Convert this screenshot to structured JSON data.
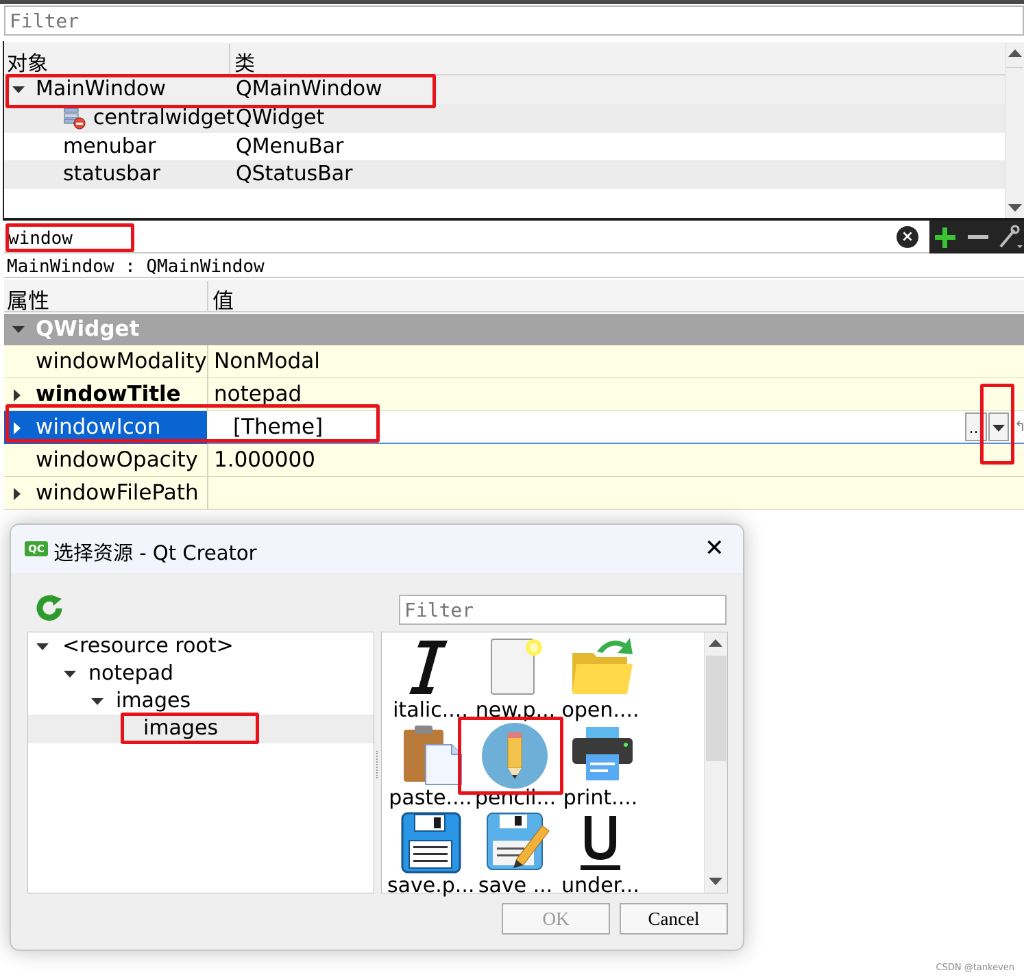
{
  "object_inspector": {
    "filter_placeholder": "Filter",
    "columns": [
      "对象",
      "类"
    ],
    "rows": [
      {
        "object": "MainWindow",
        "class": "QMainWindow"
      },
      {
        "object": "centralwidget",
        "class": "QWidget"
      },
      {
        "object": "menubar",
        "class": "QMenuBar"
      },
      {
        "object": "statusbar",
        "class": "QStatusBar"
      }
    ]
  },
  "property_editor": {
    "filter_value": "window",
    "class_label": "MainWindow : QMainWindow",
    "columns": [
      "属性",
      "值"
    ],
    "group": "QWidget",
    "rows": [
      {
        "name": "windowModality",
        "value": "NonModal"
      },
      {
        "name": "windowTitle",
        "value": "notepad"
      },
      {
        "name": "windowIcon",
        "value": "[Theme]",
        "more_label": "..."
      },
      {
        "name": "windowOpacity",
        "value": "1.000000"
      },
      {
        "name": "windowFilePath",
        "value": ""
      }
    ]
  },
  "dialog": {
    "app_badge": "QC",
    "title": "选择资源 - Qt Creator",
    "filter_placeholder": "Filter",
    "tree": [
      "<resource root>",
      "notepad",
      "images",
      "images"
    ],
    "icons": [
      {
        "label": "italic....",
        "icon": "italic-icon"
      },
      {
        "label": "new.p...",
        "icon": "new-page-icon"
      },
      {
        "label": "open....",
        "icon": "open-folder-icon"
      },
      {
        "label": "paste....",
        "icon": "paste-icon"
      },
      {
        "label": "pencil...",
        "icon": "pencil-icon"
      },
      {
        "label": "print....",
        "icon": "print-icon"
      },
      {
        "label": "save.p...",
        "icon": "save-icon"
      },
      {
        "label": "save ...",
        "icon": "save-as-icon"
      },
      {
        "label": "under...",
        "icon": "underline-icon"
      }
    ],
    "ok_label": "OK",
    "cancel_label": "Cancel"
  },
  "watermark": "CSDN @tankeven",
  "colors": {
    "selection": "#0a64d1",
    "highlight_box": "#e8121b",
    "property_row": "#ffffe6",
    "group_row": "#a4a4a4"
  }
}
